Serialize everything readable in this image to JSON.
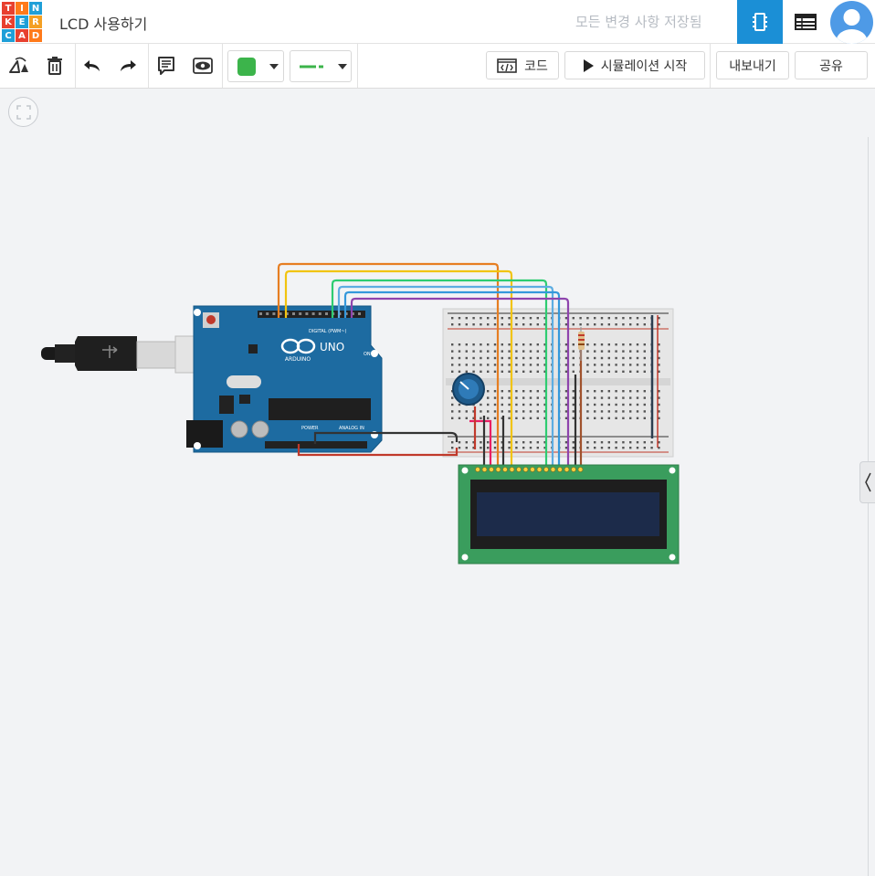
{
  "app": {
    "logo_letters": [
      "T",
      "I",
      "N",
      "K",
      "E",
      "R",
      "C",
      "A",
      "D"
    ],
    "logo_colors": [
      "#e8402f",
      "#ff7a1a",
      "#1f9fd8",
      "#e8402f",
      "#1f9fd8",
      "#f4a024",
      "#1f9fd8",
      "#e8402f",
      "#ff7a1a"
    ],
    "title": "LCD 사용하기",
    "save_status": "모든 변경 사항 저장됨"
  },
  "header": {
    "components_icon": "chip-icon",
    "components_list_icon": "table-icon",
    "accent": "#1b8fd6"
  },
  "toolbar": {
    "code_label": "코드",
    "simulate_label": "시뮬레이션 시작",
    "export_label": "내보내기",
    "share_label": "공유",
    "wire_color": "#3cb44b"
  },
  "board": {
    "digital_label": "DIGITAL (PWM~)",
    "power_label": "POWER",
    "analog_label": "ANALOG IN",
    "brand": "ARDUINO",
    "model": "UNO",
    "on_label": "ON"
  }
}
